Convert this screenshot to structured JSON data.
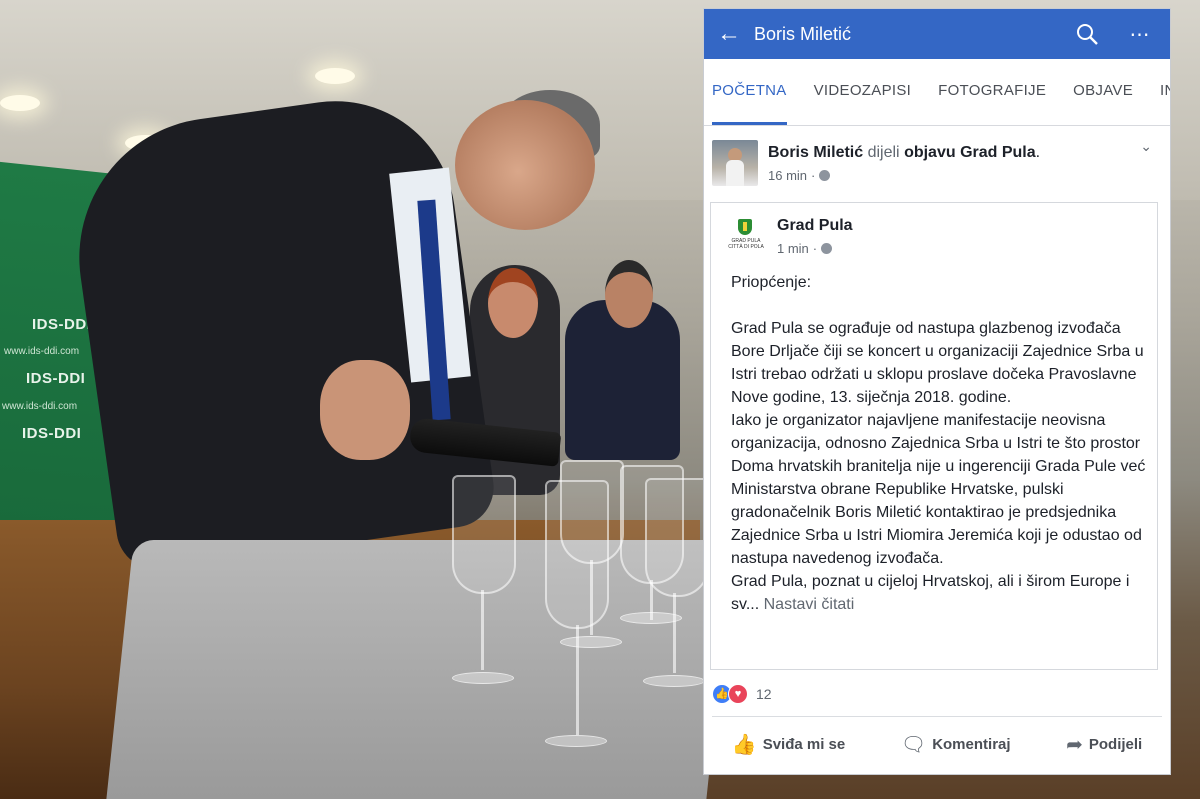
{
  "header": {
    "title": "Boris Miletić",
    "back_icon": "arrow-left-icon",
    "search_icon": "search-icon",
    "more_icon": "more-dots-icon",
    "accent": "#3467c5"
  },
  "tabs": [
    {
      "label": "POČETNA",
      "active": true
    },
    {
      "label": "VIDEOZAPISI",
      "active": false
    },
    {
      "label": "FOTOGRAFIJE",
      "active": false
    },
    {
      "label": "OBJAVE",
      "active": false
    },
    {
      "label": "INF",
      "active": false
    }
  ],
  "post": {
    "author": "Boris Miletić",
    "shares_text": "dijeli",
    "object_text": "objavu Grad Pula",
    "time": "16 min",
    "shared": {
      "author": "Grad Pula",
      "logo_text": "GRAD PULA CITTÀ DI POLA",
      "time": "1 min",
      "heading": "Priopćenje:",
      "paragraph1": "Grad Pula se ograđuje od nastupa glazbenog izvođača Bore Drljače čiji se koncert u organizaciji Zajednice Srba u Istri trebao održati u sklopu proslave dočeka Pravoslavne Nove godine, 13. siječnja 2018. godine.",
      "paragraph2": "Iako je organizator najavljene manifestacije neovisna organizacija, odnosno Zajednica Srba u Istri te što prostor Doma hrvatskih branitelja nije u ingerenciji Grada Pule već Ministarstva obrane Republike Hrvatske, pulski gradonačelnik Boris Miletić kontaktirao je predsjednika Zajednice Srba u Istri Miomira Jeremića koji je odustao od nastupa navedenog izvođača.",
      "paragraph3": "Grad Pula, poznat u cijeloj Hrvatskoj, ali i širom Europe i sv...",
      "read_more": "Nastavi čitati"
    },
    "reactions_count": "12",
    "actions": {
      "like": "Sviđa mi se",
      "comment": "Komentiraj",
      "share": "Podijeli"
    }
  },
  "photo": {
    "wall_logo": "IDS-DDI",
    "wall_web": "www.ids-ddi.com"
  }
}
